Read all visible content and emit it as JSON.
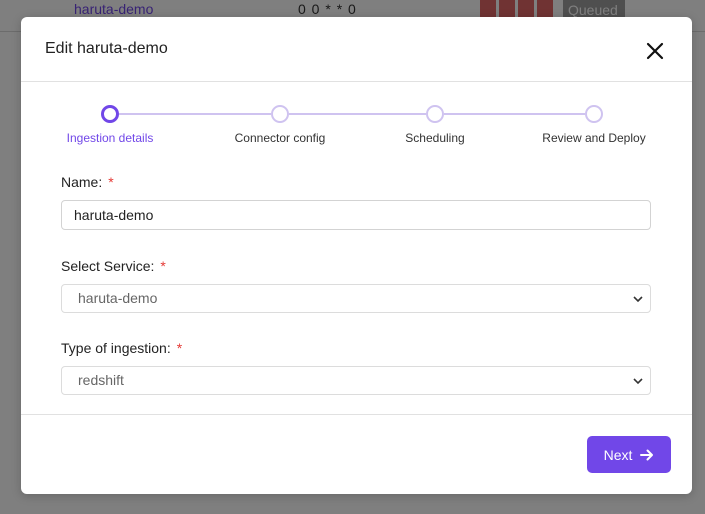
{
  "background": {
    "row": {
      "link": "haruta-demo",
      "cron": "0 0 * * 0",
      "status": "Queued"
    }
  },
  "modal": {
    "title": "Edit haruta-demo",
    "steps": [
      {
        "label": "Ingestion details"
      },
      {
        "label": "Connector config"
      },
      {
        "label": "Scheduling"
      },
      {
        "label": "Review and Deploy"
      }
    ],
    "required_mark": "*",
    "fields": {
      "name": {
        "label": "Name:",
        "value": "haruta-demo"
      },
      "service": {
        "label": "Select Service:",
        "value": "haruta-demo"
      },
      "ingestion_type": {
        "label": "Type of ingestion:",
        "value": "redshift"
      }
    },
    "next_label": "Next",
    "accent": "#7147e8"
  }
}
